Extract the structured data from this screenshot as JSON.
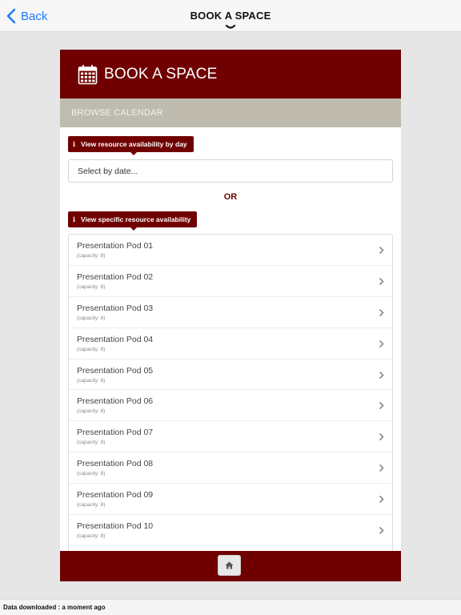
{
  "nav": {
    "back_label": "Back",
    "title": "BOOK A SPACE"
  },
  "panel": {
    "title": "BOOK A SPACE",
    "subheader": "BROWSE CALENDAR",
    "tip_by_day": "View resource availability by day",
    "date_placeholder": "Select by date...",
    "or_label": "OR",
    "tip_specific": "View specific resource availability",
    "info_glyph": "i"
  },
  "resources": [
    {
      "name": "Presentation Pod 01",
      "capacity": "(capacity: 8)"
    },
    {
      "name": "Presentation Pod 02",
      "capacity": "(capacity: 8)"
    },
    {
      "name": "Presentation Pod 03",
      "capacity": "(capacity: 8)"
    },
    {
      "name": "Presentation Pod 04",
      "capacity": "(capacity: 8)"
    },
    {
      "name": "Presentation Pod 05",
      "capacity": "(capacity: 8)"
    },
    {
      "name": "Presentation Pod 06",
      "capacity": "(capacity: 8)"
    },
    {
      "name": "Presentation Pod 07",
      "capacity": "(capacity: 8)"
    },
    {
      "name": "Presentation Pod 08",
      "capacity": "(capacity: 8)"
    },
    {
      "name": "Presentation Pod 09",
      "capacity": "(capacity: 8)"
    },
    {
      "name": "Presentation Pod 10",
      "capacity": "(capacity: 8)"
    }
  ],
  "footer": {
    "home_icon": "home-icon"
  },
  "status": {
    "text": "Data downloaded : a moment ago"
  },
  "colors": {
    "brand": "#700000",
    "subheader": "#bfbbae",
    "link": "#1a7cf6",
    "background": "#e6e6e6"
  }
}
